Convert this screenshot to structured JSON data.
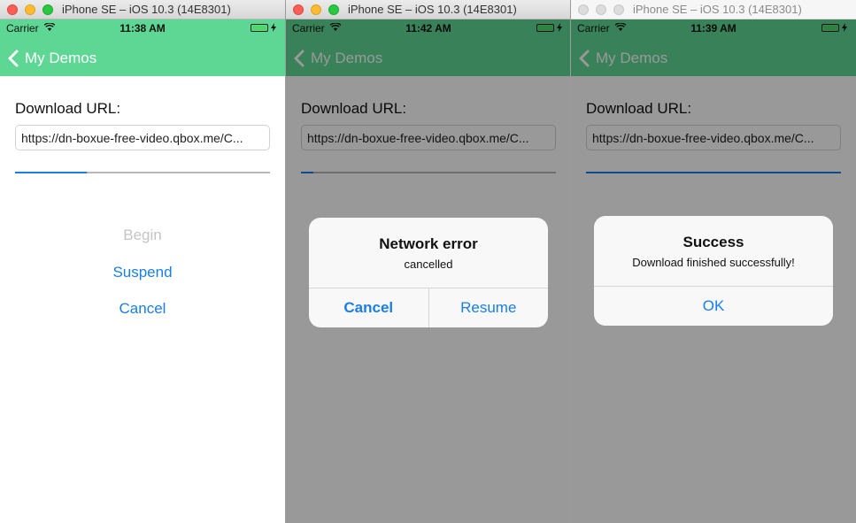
{
  "windows": [
    {
      "title": "iPhone SE – iOS 10.3 (14E8301)",
      "status": {
        "carrier": "Carrier",
        "time": "11:38 AM"
      },
      "nav": {
        "back_label": "My Demos",
        "color": "#5ed795"
      },
      "content": {
        "label": "Download URL:",
        "url": "https://dn-boxue-free-video.qbox.me/C...",
        "progress": 0.28,
        "buttons": {
          "begin": "Begin",
          "suspend": "Suspend",
          "cancel": "Cancel"
        }
      }
    },
    {
      "title": "iPhone SE – iOS 10.3 (14E8301)",
      "status": {
        "carrier": "Carrier",
        "time": "11:42 AM"
      },
      "nav": {
        "back_label": "My Demos"
      },
      "content": {
        "label": "Download URL:",
        "url": "https://dn-boxue-free-video.qbox.me/C...",
        "progress": 0.05
      },
      "alert": {
        "title": "Network error",
        "message": "cancelled",
        "cancel_label": "Cancel",
        "resume_label": "Resume"
      }
    },
    {
      "title": "iPhone SE – iOS 10.3 (14E8301)",
      "status": {
        "carrier": "Carrier",
        "time": "11:39 AM"
      },
      "nav": {
        "back_label": "My Demos"
      },
      "content": {
        "label": "Download URL:",
        "url": "https://dn-boxue-free-video.qbox.me/C...",
        "progress": 1.0
      },
      "alert": {
        "title": "Success",
        "message": "Download finished successfully!",
        "ok_label": "OK"
      }
    }
  ],
  "colors": {
    "accent": "#1a7ee8",
    "nav": "#5ed795",
    "battery": "#4cd964"
  },
  "icons": [
    "wifi-icon",
    "battery-icon",
    "charging-bolt-icon",
    "back-chevron-icon"
  ]
}
